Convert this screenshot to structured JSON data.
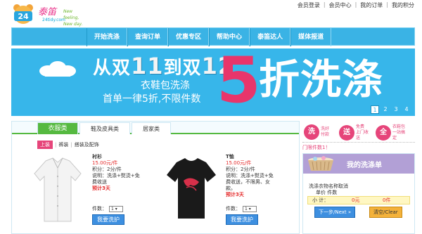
{
  "logo": {
    "cn": "泰笛",
    "url": "24tidy.com",
    "slogan1": "New feeling,",
    "slogan2": "New day.",
    "badge": "24"
  },
  "toplinks": [
    "会员登录",
    "会员中心",
    "我的订单",
    "我的积分"
  ],
  "nav": [
    "开始洗涤",
    "查询订单",
    "优惠专区",
    "帮助中心",
    "泰笛达人",
    "媒体报道"
  ],
  "banner": {
    "line1_a": "从双",
    "line1_b": "11",
    "line1_c": "到双",
    "line1_d": "12",
    "line2": "衣鞋包洗涤",
    "line3": "首单一律5折,不限件数",
    "five": "5",
    "word": "折洗涤",
    "pages": [
      "1",
      "2",
      "3",
      "4"
    ],
    "active_page": "1"
  },
  "tabs": [
    "衣服类",
    "鞋及皮具类",
    "居家类"
  ],
  "subtabs": [
    "上装",
    "裤装",
    "搭装及配饰"
  ],
  "products": [
    {
      "name": "衬衫",
      "price": "15.00元/件",
      "points": "积分：2分/件",
      "desc1": "说明：洗涤+熨烫+免",
      "desc2": "费收送",
      "ret": "预计3天",
      "qty_label": "件数：",
      "qty": "1",
      "button": "我要洗护"
    },
    {
      "name": "T恤",
      "price": "15.00元/件",
      "points": "积分：2分/件",
      "desc1": "说明：洗涤+熨烫+免",
      "desc2": "费收送，不限男、女",
      "desc3": "款。",
      "ret": "预计3天",
      "qty_label": "件数：",
      "qty": "1",
      "button": "我要洗护"
    }
  ],
  "features": [
    {
      "icon": "洗",
      "text1": "洗好",
      "text2": "付款"
    },
    {
      "icon": "送",
      "text1": "免费",
      "text2": "上门收送"
    },
    {
      "icon": "全",
      "text1": "衣鞋包",
      "text2": "一站搞定"
    }
  ],
  "promo": "门限件数1！",
  "cart": {
    "title": "我的洗涤单",
    "col1": "洗涤衣物名称取消",
    "col2": "单价   件数",
    "total_label": "小  计：",
    "total_price": "0元",
    "total_count": "0件",
    "next": "下一步/Next »",
    "clear": "清空/Clear"
  }
}
